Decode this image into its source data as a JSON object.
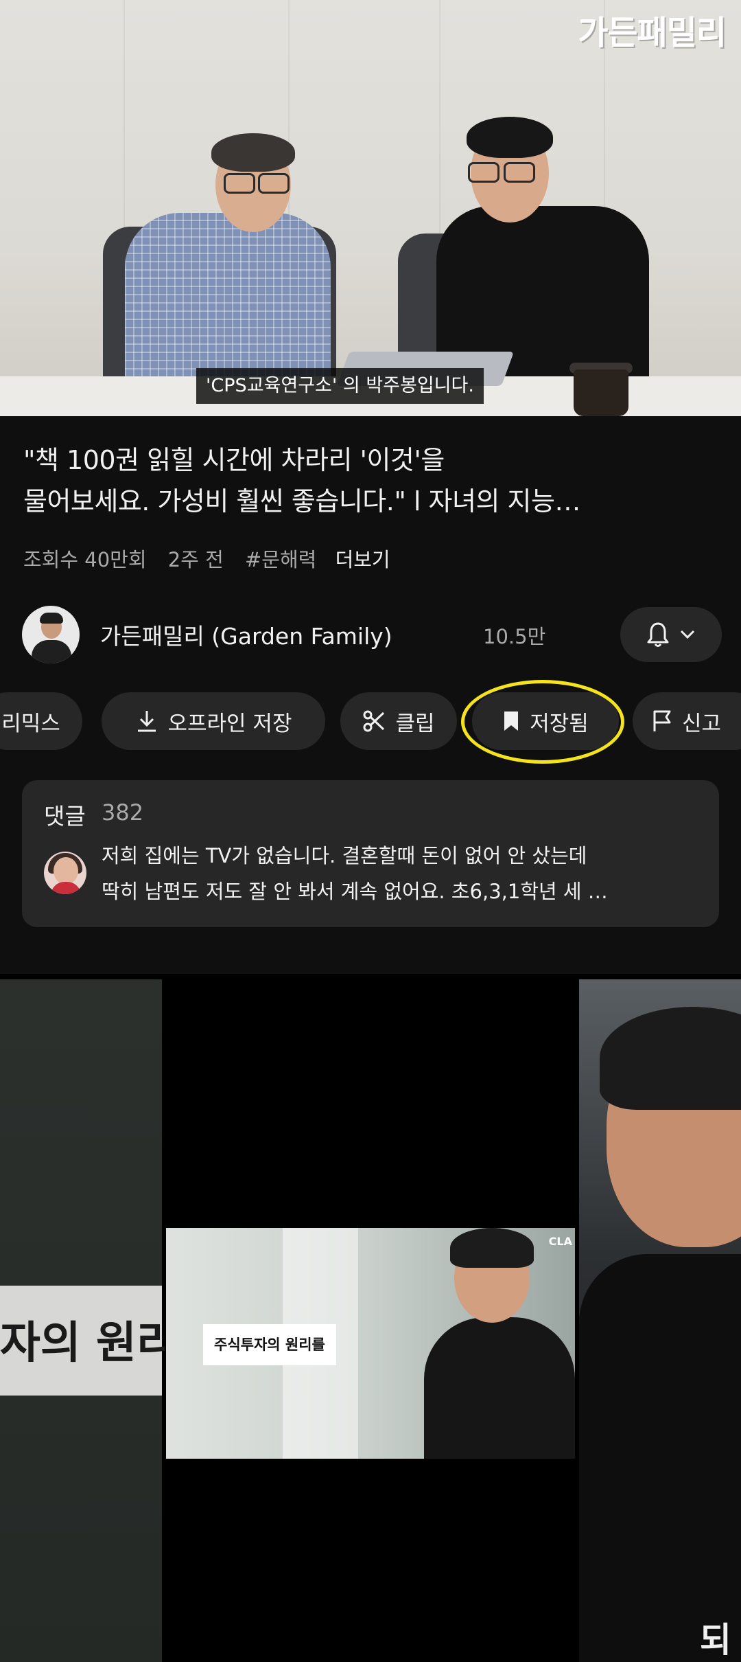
{
  "player": {
    "watermark": "가든패밀리",
    "caption": "'CPS교육연구소' 의  박주봉입니다."
  },
  "video": {
    "title_line1": "\"책 100권 읽힐 시간에 차라리 '이것'을",
    "title_line2": "물어보세요. 가성비 훨씬 좋습니다.\" l 자녀의 지능…",
    "views": "조회수 40만회",
    "age": "2주 전",
    "hashtag": "#문해력",
    "more": "더보기"
  },
  "channel": {
    "name": "가든패밀리 (Garden Family)",
    "subscribers": "10.5만",
    "bell_icon": "bell-icon",
    "chevron_icon": "chevron-down-icon"
  },
  "actions": {
    "remix": "리믹스",
    "offline_save": "오프라인 저장",
    "clip": "클립",
    "saved": "저장됨",
    "report": "신고"
  },
  "highlight_color": "#f5e31c",
  "comments": {
    "title": "댓글",
    "count": "382",
    "line1": "저희 집에는 TV가 없습니다. 결혼할때 돈이 없어 안 샀는데",
    "line2": "딱히 남편도 저도 잘 안 봐서 계속 없어요. 초6,3,1학년 세 …"
  },
  "next_video": {
    "left_overlay": "자의 원리",
    "thumb_label": "주식투자의 원리를",
    "thumb_logo": "CLA",
    "end_glyph": "되"
  }
}
